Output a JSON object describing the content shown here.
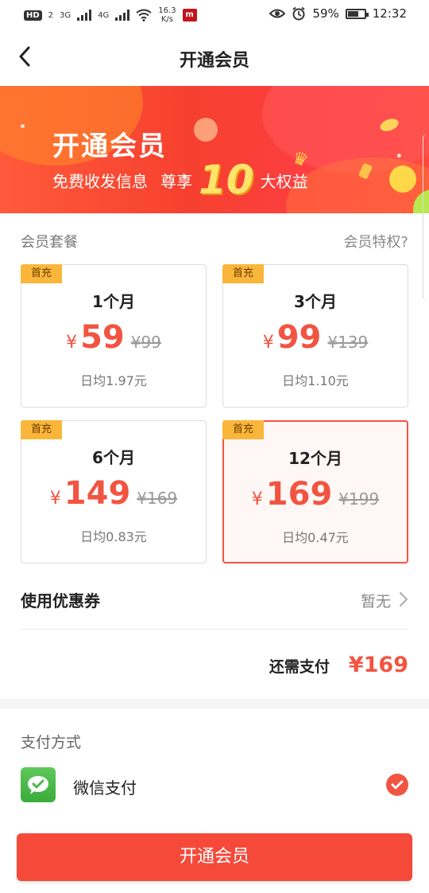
{
  "status_bar": {
    "hd": "HD",
    "hd_sub": "2",
    "net1": "3G",
    "net2": "4G",
    "speed_value": "16.3",
    "speed_unit": "K/s",
    "app_badge": "m",
    "battery": "59%",
    "battery_level": 0.59,
    "time": "12:32",
    "icons": [
      "signal-icon",
      "wifi-icon",
      "eye-icon",
      "alarm-icon",
      "battery-icon"
    ]
  },
  "nav": {
    "back_icon": "chevron-left-icon",
    "title": "开通会员"
  },
  "banner": {
    "title": "开通会员",
    "sub_pre": "免费收发信息",
    "sub_mid": "尊享",
    "number": "10",
    "sub_post": "大权益"
  },
  "packages": {
    "header": "会员套餐",
    "privilege_link": "会员特权?",
    "items": [
      {
        "tag": "首充",
        "period": "1个月",
        "currency": "¥",
        "price": "59",
        "old_price": "¥99",
        "avg": "日均1.97元"
      },
      {
        "tag": "首充",
        "period": "3个月",
        "currency": "¥",
        "price": "99",
        "old_price": "¥139",
        "avg": "日均1.10元"
      },
      {
        "tag": "首充",
        "period": "6个月",
        "currency": "¥",
        "price": "149",
        "old_price": "¥169",
        "avg": "日均0.83元"
      },
      {
        "tag": "首充",
        "period": "12个月",
        "currency": "¥",
        "price": "169",
        "old_price": "¥199",
        "avg": "日均0.47元"
      }
    ],
    "selected_index": 3
  },
  "coupon": {
    "label": "使用优惠券",
    "value": "暂无"
  },
  "due": {
    "label": "还需支付",
    "amount": "¥169"
  },
  "payment": {
    "header": "支付方式",
    "method": "微信支付",
    "icon": "wechat-icon",
    "selected": true
  },
  "cta": {
    "label": "开通会员"
  },
  "colors": {
    "accent": "#f25442",
    "tag": "#f9b63a",
    "wechat": "#4cb84a"
  }
}
